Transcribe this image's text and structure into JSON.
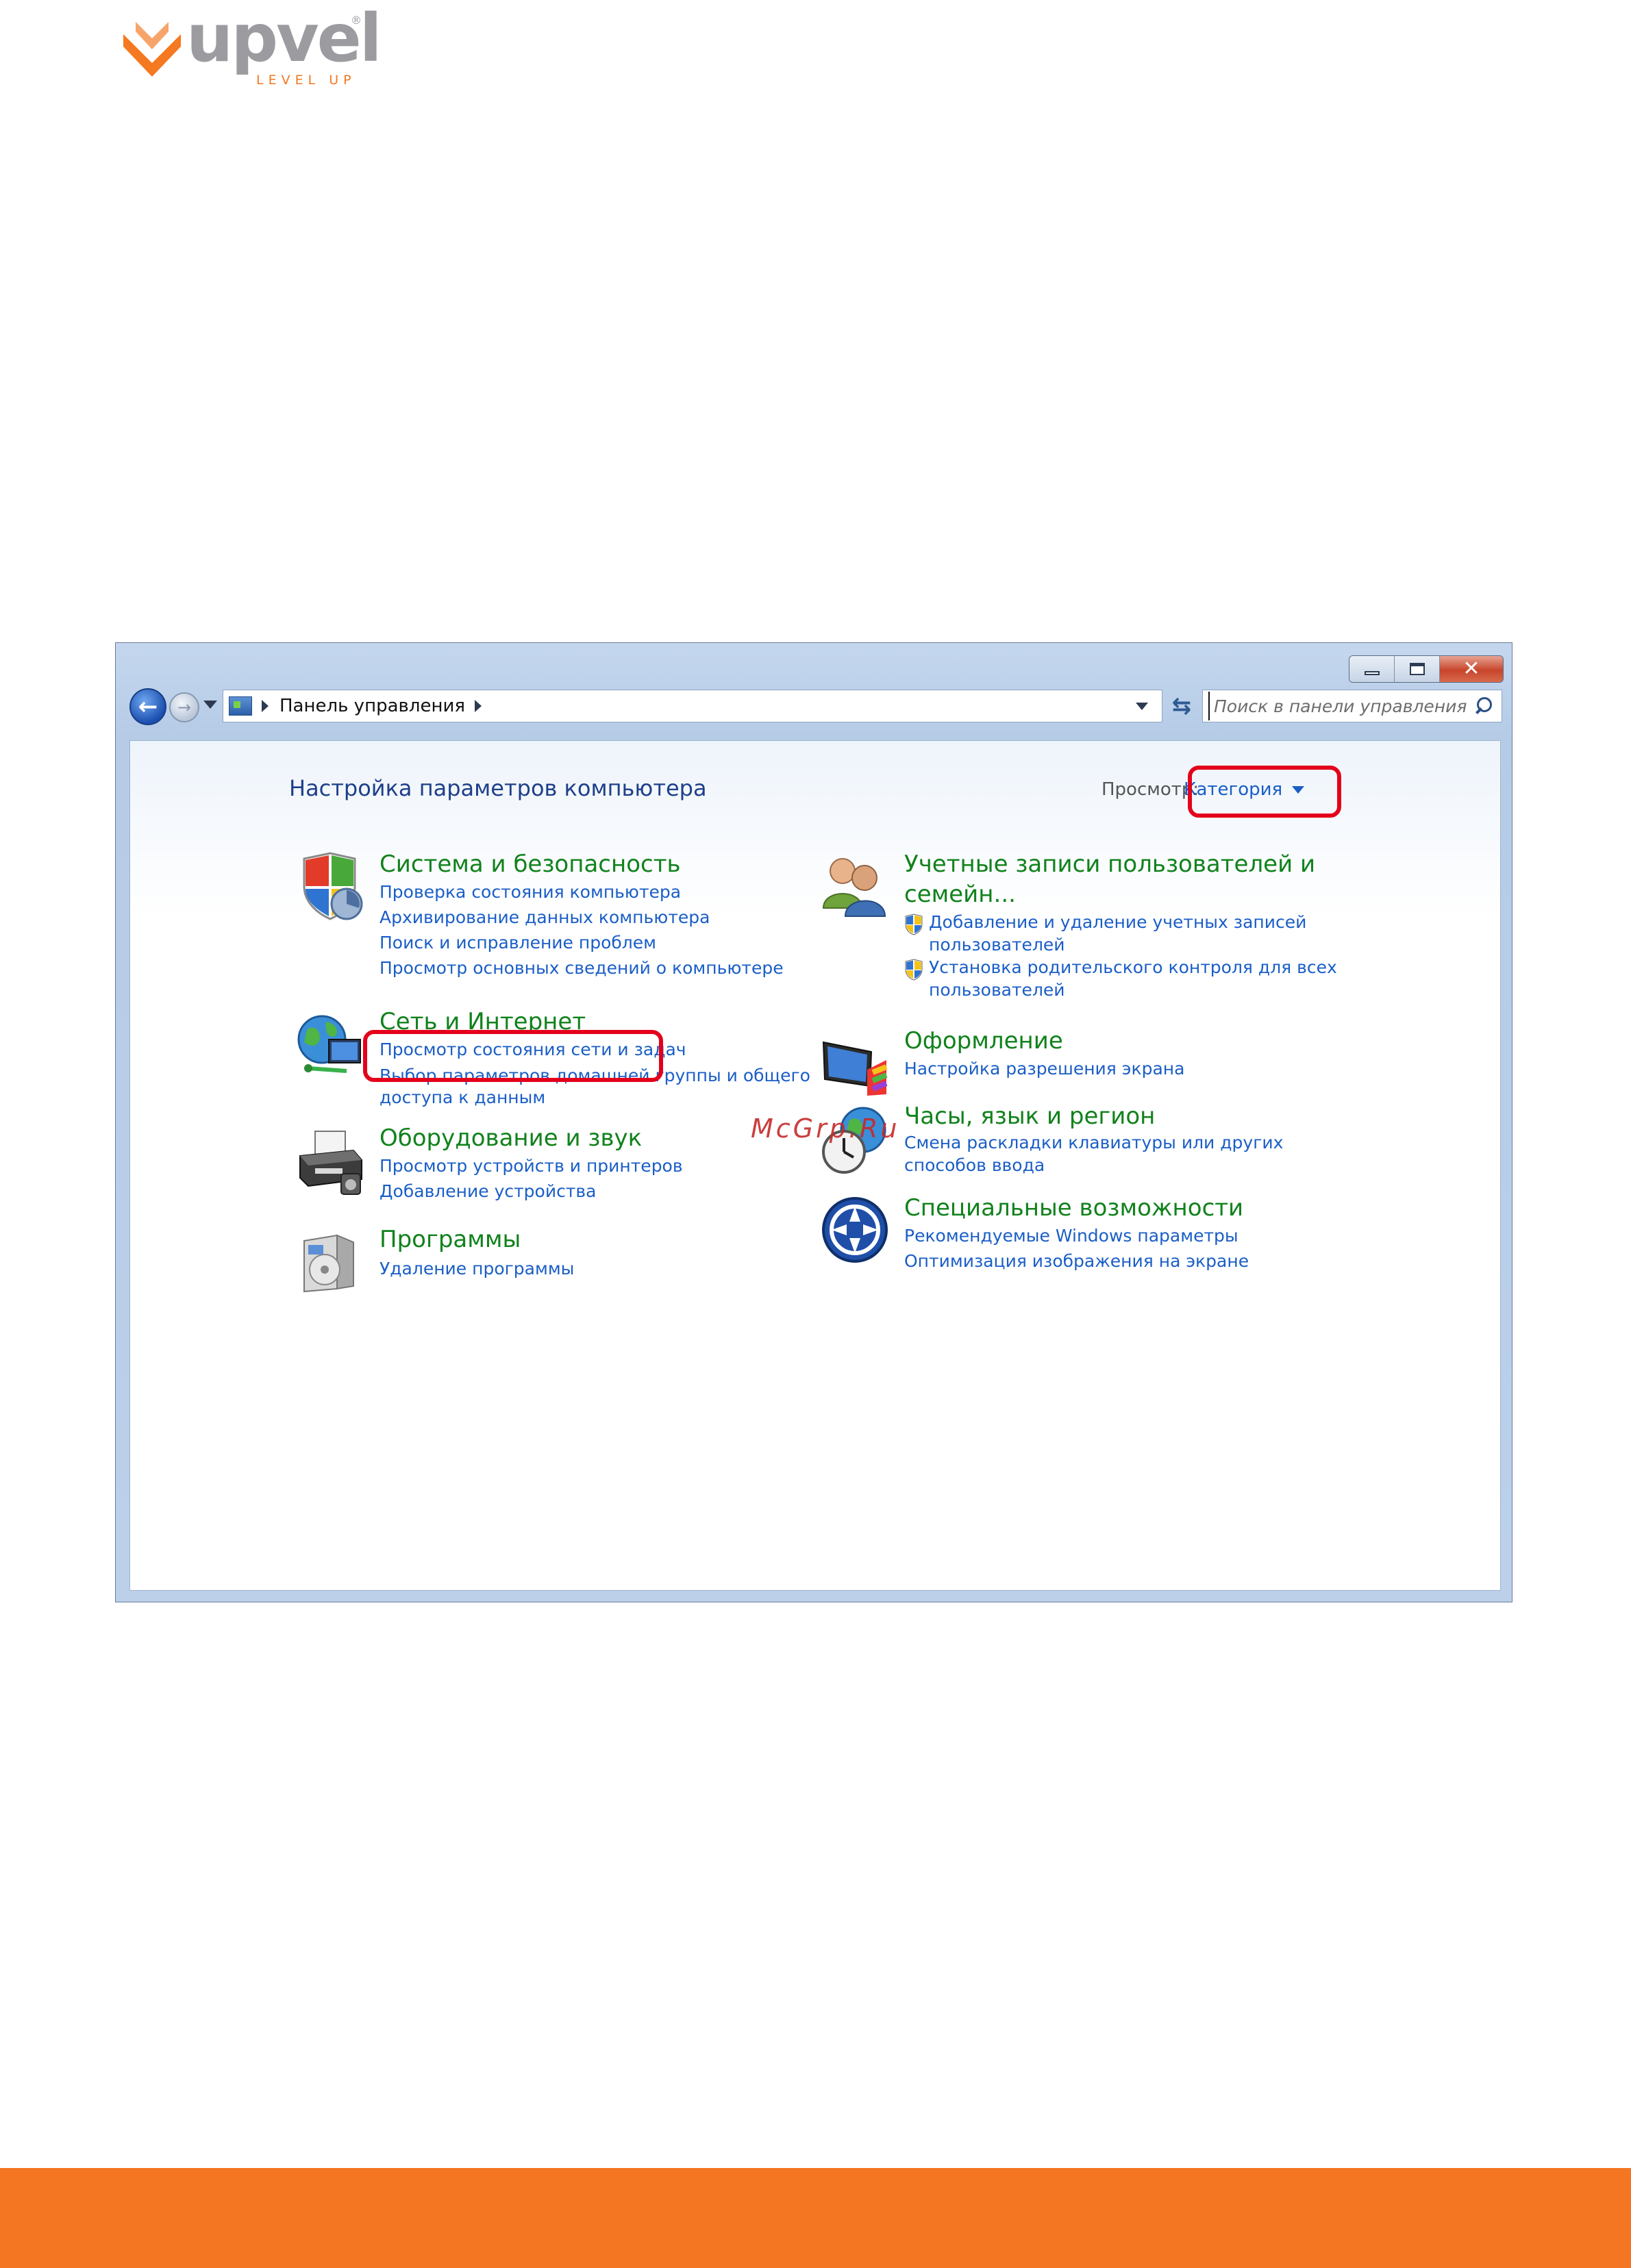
{
  "brand": {
    "name": "upvel",
    "tagline": "LEVEL UP",
    "reg_mark": "®",
    "color": "#f47920"
  },
  "window": {
    "address": {
      "crumb": "Панель управления"
    },
    "search": {
      "placeholder": "Поиск в панели управления"
    },
    "heading": "Настройка параметров компьютера",
    "view": {
      "label": "Просмотр:",
      "value": "Категория"
    },
    "categories_left": [
      {
        "icon": "security-shield-icon",
        "title": "Система и безопасность",
        "links": [
          "Проверка состояния компьютера",
          "Архивирование данных компьютера",
          "Поиск и исправление проблем",
          "Просмотр основных сведений о компьютере"
        ]
      },
      {
        "icon": "network-globe-icon",
        "title": "Сеть и Интернет",
        "links": [
          "Просмотр состояния сети и задач",
          "Выбор параметров домашней группы и общего",
          "доступа к данным"
        ]
      },
      {
        "icon": "printer-icon",
        "title": "Оборудование и звук",
        "links": [
          "Просмотр устройств и принтеров",
          "Добавление устройства"
        ]
      },
      {
        "icon": "programs-icon",
        "title": "Программы",
        "links": [
          "Удаление программы"
        ]
      }
    ],
    "categories_right": [
      {
        "icon": "users-icon",
        "title_line1": "Учетные записи пользователей и",
        "title_line2": "семейн...",
        "links": [
          {
            "line1": "Добавление и удаление учетных записей",
            "line2": "пользователей"
          },
          {
            "line1": "Установка родительского контроля для всех",
            "line2": "пользователей"
          }
        ]
      },
      {
        "icon": "appearance-monitor-icon",
        "title": "Оформление",
        "links": [
          "Настройка разрешения экрана"
        ]
      },
      {
        "icon": "clock-globe-icon",
        "title": "Часы, язык и регион",
        "links": [
          "Смена раскладки клавиатуры или других",
          "способов ввода"
        ]
      },
      {
        "icon": "ease-of-access-icon",
        "title": "Специальные возможности",
        "links": [
          "Рекомендуемые Windows параметры",
          "Оптимизация изображения на экране"
        ]
      }
    ]
  },
  "watermark": "McGrp.Ru",
  "colors": {
    "link": "#1a5ec7",
    "category": "#11821c",
    "highlight": "#e4001b",
    "footer": "#f47522"
  }
}
